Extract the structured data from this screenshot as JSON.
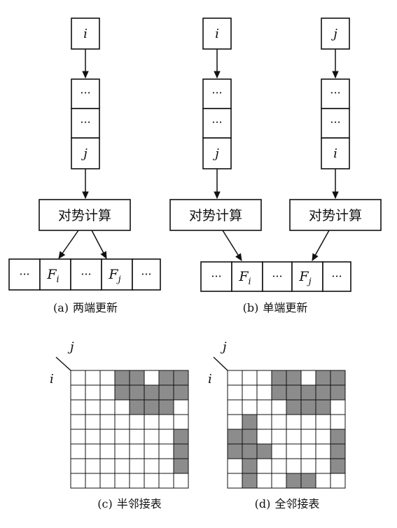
{
  "panel_a": {
    "top": "i",
    "stack": [
      "···",
      "···",
      "j"
    ],
    "compute": "对势计算",
    "array": [
      {
        "base": "···",
        "sub": ""
      },
      {
        "base": "F",
        "sub": "i"
      },
      {
        "base": "···",
        "sub": ""
      },
      {
        "base": "F",
        "sub": "j"
      },
      {
        "base": "···",
        "sub": ""
      }
    ],
    "caption_prefix": "(a)",
    "caption_text": "两端更新"
  },
  "panel_b": {
    "left_top": "i",
    "left_stack": [
      "···",
      "···",
      "j"
    ],
    "right_top": "j",
    "right_stack": [
      "···",
      "···",
      "i"
    ],
    "compute_left": "对势计算",
    "compute_right": "对势计算",
    "array": [
      {
        "base": "···",
        "sub": ""
      },
      {
        "base": "F",
        "sub": "i"
      },
      {
        "base": "···",
        "sub": ""
      },
      {
        "base": "F",
        "sub": "j"
      },
      {
        "base": "···",
        "sub": ""
      }
    ],
    "caption_prefix": "(b)",
    "caption_text": "单端更新"
  },
  "panel_c": {
    "col_label": "j",
    "row_label": "i",
    "fill_color": "#8c8c8c",
    "filled_cells": [
      [
        0,
        3
      ],
      [
        0,
        4
      ],
      [
        0,
        6
      ],
      [
        0,
        7
      ],
      [
        1,
        3
      ],
      [
        1,
        4
      ],
      [
        1,
        5
      ],
      [
        1,
        6
      ],
      [
        1,
        7
      ],
      [
        2,
        4
      ],
      [
        2,
        5
      ],
      [
        2,
        6
      ],
      [
        4,
        7
      ],
      [
        5,
        7
      ],
      [
        6,
        7
      ]
    ],
    "caption_prefix": "(c)",
    "caption_text": "半邻接表"
  },
  "panel_d": {
    "col_label": "j",
    "row_label": "i",
    "fill_color": "#8c8c8c",
    "filled_cells": [
      [
        0,
        3
      ],
      [
        0,
        4
      ],
      [
        0,
        6
      ],
      [
        0,
        7
      ],
      [
        1,
        3
      ],
      [
        1,
        4
      ],
      [
        1,
        5
      ],
      [
        1,
        6
      ],
      [
        1,
        7
      ],
      [
        2,
        4
      ],
      [
        2,
        5
      ],
      [
        2,
        6
      ],
      [
        3,
        1
      ],
      [
        4,
        0
      ],
      [
        4,
        1
      ],
      [
        4,
        7
      ],
      [
        5,
        0
      ],
      [
        5,
        1
      ],
      [
        5,
        2
      ],
      [
        5,
        7
      ],
      [
        6,
        1
      ],
      [
        6,
        7
      ],
      [
        7,
        1
      ],
      [
        7,
        4
      ],
      [
        7,
        5
      ]
    ],
    "caption_prefix": "(d)",
    "caption_text": "全邻接表"
  }
}
